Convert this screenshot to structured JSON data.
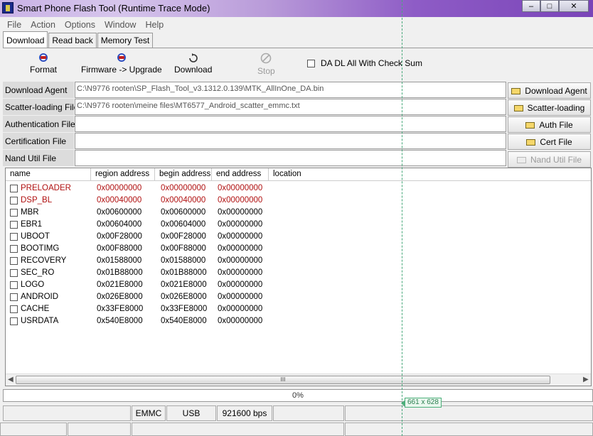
{
  "window": {
    "title": "Smart Phone Flash Tool (Runtime Trace Mode)",
    "min_glyph": "–",
    "max_glyph": "□",
    "close_glyph": "✕"
  },
  "menu": [
    "File",
    "Action",
    "Options",
    "Window",
    "Help"
  ],
  "tabs": [
    "Download",
    "Read back",
    "Memory Test"
  ],
  "toolbar": {
    "format": "Format",
    "firmware_upgrade": "Firmware -> Upgrade",
    "download": "Download",
    "stop": "Stop",
    "da_checksum": "DA DL All With Check Sum"
  },
  "files": {
    "download_agent": {
      "label": "Download Agent",
      "value": "C:\\N9776 rooten\\SP_Flash_Tool_v3.1312.0.139\\MTK_AllInOne_DA.bin",
      "button": "Download Agent"
    },
    "scatter": {
      "label": "Scatter-loading File",
      "value": "C:\\N9776 rooten\\meine files\\MT6577_Android_scatter_emmc.txt",
      "button": "Scatter-loading"
    },
    "auth": {
      "label": "Authentication File",
      "value": "",
      "button": "Auth File"
    },
    "cert": {
      "label": "Certification File",
      "value": "",
      "button": "Cert File"
    },
    "nand": {
      "label": "Nand Util File",
      "value": "",
      "button": "Nand Util File"
    }
  },
  "table": {
    "headers": [
      "name",
      "region address",
      "begin address",
      "end address",
      "location"
    ],
    "rows": [
      {
        "name": "PRELOADER",
        "region": "0x00000000",
        "begin": "0x00000000",
        "end": "0x00000000",
        "location": ""
      },
      {
        "name": "DSP_BL",
        "region": "0x00040000",
        "begin": "0x00040000",
        "end": "0x00000000",
        "location": ""
      },
      {
        "name": "MBR",
        "region": "0x00600000",
        "begin": "0x00600000",
        "end": "0x00000000",
        "location": ""
      },
      {
        "name": "EBR1",
        "region": "0x00604000",
        "begin": "0x00604000",
        "end": "0x00000000",
        "location": ""
      },
      {
        "name": "UBOOT",
        "region": "0x00F28000",
        "begin": "0x00F28000",
        "end": "0x00000000",
        "location": ""
      },
      {
        "name": "BOOTIMG",
        "region": "0x00F88000",
        "begin": "0x00F88000",
        "end": "0x00000000",
        "location": ""
      },
      {
        "name": "RECOVERY",
        "region": "0x01588000",
        "begin": "0x01588000",
        "end": "0x00000000",
        "location": ""
      },
      {
        "name": "SEC_RO",
        "region": "0x01B88000",
        "begin": "0x01B88000",
        "end": "0x00000000",
        "location": ""
      },
      {
        "name": "LOGO",
        "region": "0x021E8000",
        "begin": "0x021E8000",
        "end": "0x00000000",
        "location": ""
      },
      {
        "name": "ANDROID",
        "region": "0x026E8000",
        "begin": "0x026E8000",
        "end": "0x00000000",
        "location": ""
      },
      {
        "name": "CACHE",
        "region": "0x33FE8000",
        "begin": "0x33FE8000",
        "end": "0x00000000",
        "location": ""
      },
      {
        "name": "USRDATA",
        "region": "0x540E8000",
        "begin": "0x540E8000",
        "end": "0x00000000",
        "location": ""
      }
    ],
    "scroll_left": "◀",
    "scroll_right": "▶",
    "scroll_grip": "III"
  },
  "progress": {
    "text": "0%",
    "value": 0
  },
  "statusbar": {
    "storage": "EMMC",
    "port": "USB",
    "baud": "921600 bps"
  },
  "overlay": {
    "size": "661 x 628"
  },
  "colors": {
    "error_row": "#b01010",
    "titlebar_end": "#7a44b8",
    "guide": "#47a87a"
  }
}
